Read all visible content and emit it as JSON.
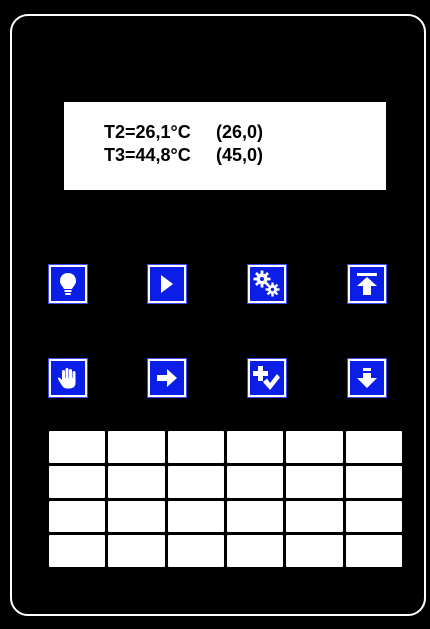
{
  "display": {
    "line1": {
      "label": "T2=26,1°C",
      "setpoint": "(26,0)"
    },
    "line2": {
      "label": "T3=44,8°C",
      "setpoint": "(45,0)"
    }
  },
  "keys_row1": [
    {
      "icon": "lightbulb-icon"
    },
    {
      "icon": "play-icon"
    },
    {
      "icon": "gears-icon"
    },
    {
      "icon": "arrow-up-to-top-icon"
    }
  ],
  "keys_row2": [
    {
      "icon": "hand-icon"
    },
    {
      "icon": "arrow-right-icon"
    },
    {
      "icon": "plus-check-icon"
    },
    {
      "icon": "arrow-down-icon"
    }
  ],
  "keypad": {
    "rows": 4,
    "columns": 6
  },
  "colors": {
    "background": "#000000",
    "key_fill": "#0a1ee8",
    "lcd": "#ffffff"
  }
}
